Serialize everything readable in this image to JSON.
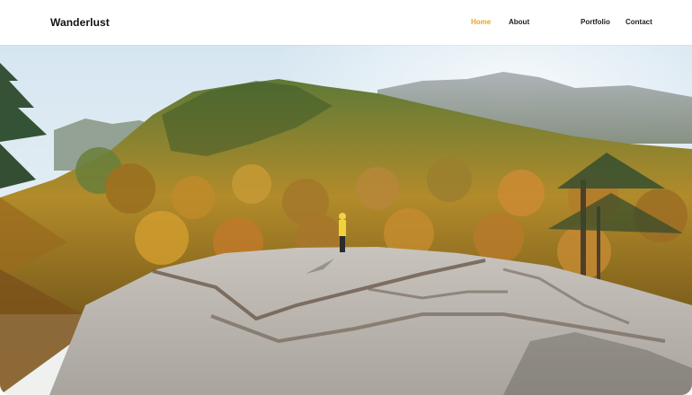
{
  "brand": {
    "name": "Wanderlust"
  },
  "nav": {
    "items": [
      {
        "label": "Home",
        "active": true
      },
      {
        "label": "About",
        "active": false
      },
      {
        "label": "Portfolio",
        "active": false
      },
      {
        "label": "Contact",
        "active": false
      }
    ]
  },
  "colors": {
    "accent": "#f3a21f",
    "nav_text": "#1d1d1d",
    "brand_text": "#111111"
  },
  "hero": {
    "scene": "autumn-mountain-landscape"
  }
}
